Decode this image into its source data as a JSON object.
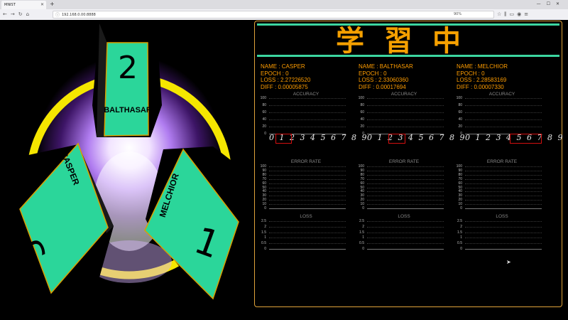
{
  "browser": {
    "tab_title": "MNIST",
    "url": "192.168.0.00:8888",
    "zoom": "90%"
  },
  "magi": {
    "units": [
      {
        "name": "BALTHASAR",
        "number": "2"
      },
      {
        "name": "CASPER",
        "number": "3"
      },
      {
        "name": "MELCHIOR",
        "number": "1"
      }
    ],
    "colors": {
      "panel": "#2bd69a",
      "frame": "#e0a000",
      "glow": "#b070ff",
      "ring": "#f5e600"
    }
  },
  "status": {
    "title": "学習中"
  },
  "charts_meta": {
    "accuracy_title": "ACCURACY",
    "error_title": "ERROR RATE",
    "loss_title": "LOSS",
    "digits": "0123456789"
  },
  "models": [
    {
      "name": "NAME : CASPER",
      "epoch": "EPOCH : 0",
      "loss": "LOSS : 2.27226520",
      "diff": "DIFF : 0.00005875"
    },
    {
      "name": "NAME : BALTHASAR",
      "epoch": "EPOCH : 0",
      "loss": "LOSS : 2.33060360",
      "diff": "DIFF : 0.00017694"
    },
    {
      "name": "NAME : MELCHIOR",
      "epoch": "EPOCH : 0",
      "loss": "LOSS : 2.28583169",
      "diff": "DIFF : 0.00007330"
    }
  ],
  "chart_data": [
    {
      "type": "line",
      "title": "ACCURACY",
      "ylim": [
        0,
        100
      ],
      "yticks": [
        "100",
        "80",
        "60",
        "40",
        "20",
        "0"
      ],
      "series": []
    },
    {
      "type": "line",
      "title": "ERROR RATE",
      "ylim": [
        0,
        100
      ],
      "yticks": [
        "100",
        "90",
        "80",
        "70",
        "60",
        "50",
        "40",
        "30",
        "20",
        "10",
        "0"
      ],
      "series": []
    },
    {
      "type": "line",
      "title": "LOSS",
      "ylim": [
        0,
        2.5
      ],
      "yticks": [
        "2.5",
        "2",
        "1.5",
        "1",
        "0.5",
        "0"
      ],
      "series": []
    }
  ]
}
